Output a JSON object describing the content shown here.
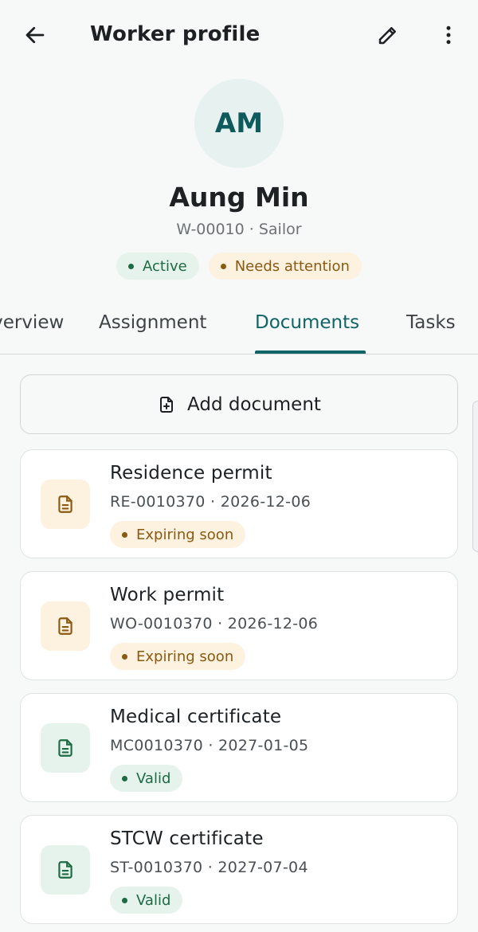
{
  "header": {
    "title": "Worker profile",
    "icons": {
      "back": "arrow-left-icon",
      "edit": "pencil-icon",
      "more": "more-vertical-icon"
    }
  },
  "profile": {
    "initials": "AM",
    "name": "Aung Min",
    "subtitle": "W-00010 · Sailor",
    "badges": [
      {
        "label": "Active",
        "tone": "green"
      },
      {
        "label": "Needs attention",
        "tone": "amber"
      }
    ]
  },
  "tabs": [
    {
      "label": "Overview",
      "selected": false
    },
    {
      "label": "Assignment",
      "selected": false
    },
    {
      "label": "Documents",
      "selected": true
    },
    {
      "label": "Tasks",
      "selected": false
    }
  ],
  "documents_tab": {
    "add_label": "Add document",
    "items": [
      {
        "title": "Residence permit",
        "meta": "RE-0010370 · 2026-12-06",
        "status": "Expiring soon",
        "tone": "amber"
      },
      {
        "title": "Work permit",
        "meta": "WO-0010370 · 2026-12-06",
        "status": "Expiring soon",
        "tone": "amber"
      },
      {
        "title": "Medical certificate",
        "meta": "MC0010370 · 2027-01-05",
        "status": "Valid",
        "tone": "green"
      },
      {
        "title": "STCW certificate",
        "meta": "ST-0010370 · 2027-07-04",
        "status": "Valid",
        "tone": "green"
      }
    ]
  },
  "colors": {
    "accent": "#0f6466",
    "green_text": "#1c6b43",
    "green_bg": "#e6f3ec",
    "amber_text": "#8a5a12",
    "amber_bg": "#fdf1df"
  }
}
